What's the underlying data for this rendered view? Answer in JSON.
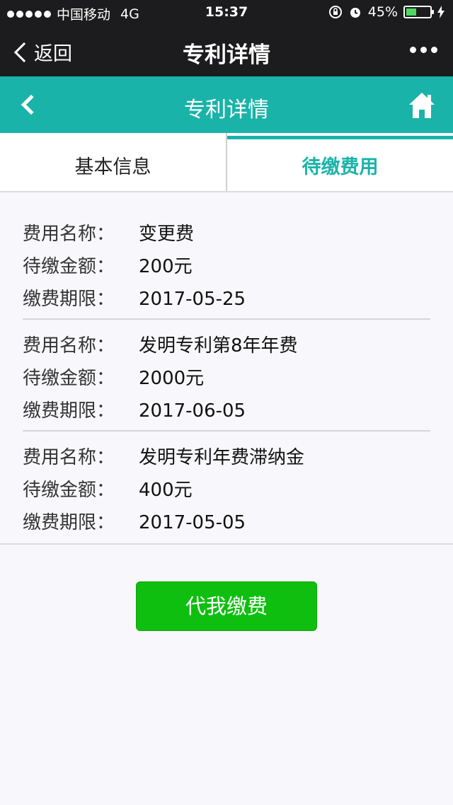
{
  "status_bar": {
    "carrier": "中国移动",
    "network": "4G",
    "time": "15:37",
    "battery_percent": "45%",
    "battery_level": 0.45,
    "battery_color": "#4cd964"
  },
  "wechat_bar": {
    "back_label": "返回",
    "title": "专利详情"
  },
  "app_header": {
    "title": "专利详情",
    "accent_color": "#1ab3a9"
  },
  "tabs": [
    {
      "label": "基本信息",
      "active": false
    },
    {
      "label": "待缴费用",
      "active": true
    }
  ],
  "fee_labels": {
    "name": "费用名称：",
    "amount": "待缴金额：",
    "deadline": "缴费期限："
  },
  "fees": [
    {
      "name": "变更费",
      "amount": "200元",
      "deadline": "2017-05-25"
    },
    {
      "name": "发明专利第8年年费",
      "amount": "2000元",
      "deadline": "2017-06-05"
    },
    {
      "name": "发明专利年费滞纳金",
      "amount": "400元",
      "deadline": "2017-05-05"
    }
  ],
  "pay_button": {
    "label": "代我缴费",
    "color": "#0fbf0f"
  },
  "icons": {
    "wechat_back": "chevron-left-icon",
    "more": "more-dots-icon",
    "app_back": "chevron-left-icon",
    "home": "home-icon"
  }
}
